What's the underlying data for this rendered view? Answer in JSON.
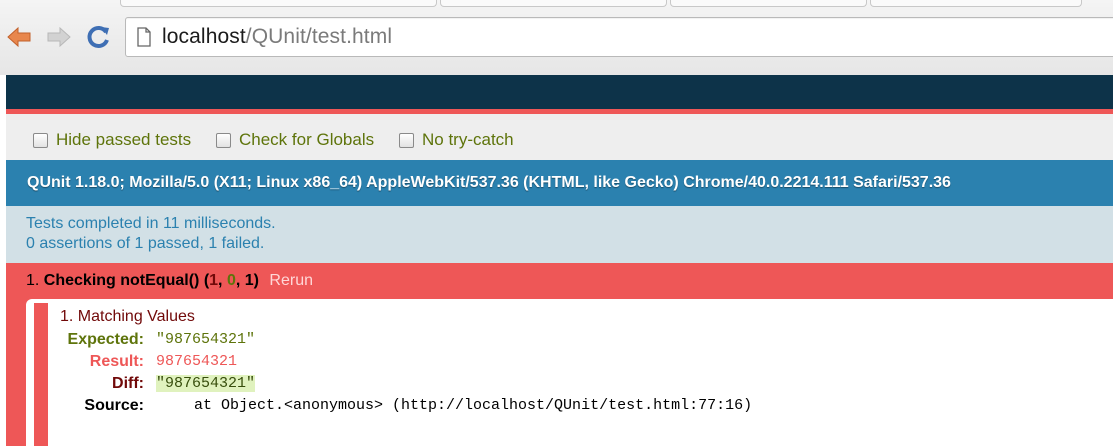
{
  "browser": {
    "url_host": "localhost",
    "url_path": "/QUnit/test.html"
  },
  "toolbar": {
    "hide_passed": "Hide passed tests",
    "check_globals": "Check for Globals",
    "no_try_catch": "No try-catch"
  },
  "user_agent": "QUnit 1.18.0; Mozilla/5.0 (X11; Linux x86_64) AppleWebKit/537.36 (KHTML, like Gecko) Chrome/40.0.2214.111 Safari/537.36",
  "summary": {
    "line1": "Tests completed in 11 milliseconds.",
    "line2": "0 assertions of 1 passed, 1 failed."
  },
  "test": {
    "number": "1.",
    "name": "Checking notEqual()",
    "failed": "1",
    "passed": "0",
    "total": "1",
    "rerun": "Rerun",
    "assertion": {
      "title": "1. Matching Values",
      "expected_label": "Expected:",
      "expected_value": "\"987654321\"",
      "result_label": "Result:",
      "result_value": "987654321",
      "diff_label": "Diff:",
      "diff_value": "\"987654321\"",
      "source_label": "Source:",
      "source_value": "at Object.<anonymous> (http://localhost/QUnit/test.html:77:16)"
    }
  },
  "colors": {
    "header": "#0d3349",
    "banner_fail": "#ee5757",
    "user_agent_bg": "#2b81af",
    "result_bg": "#d2e0e6",
    "pass_green": "#5e740b",
    "fail_dark": "#710909"
  }
}
